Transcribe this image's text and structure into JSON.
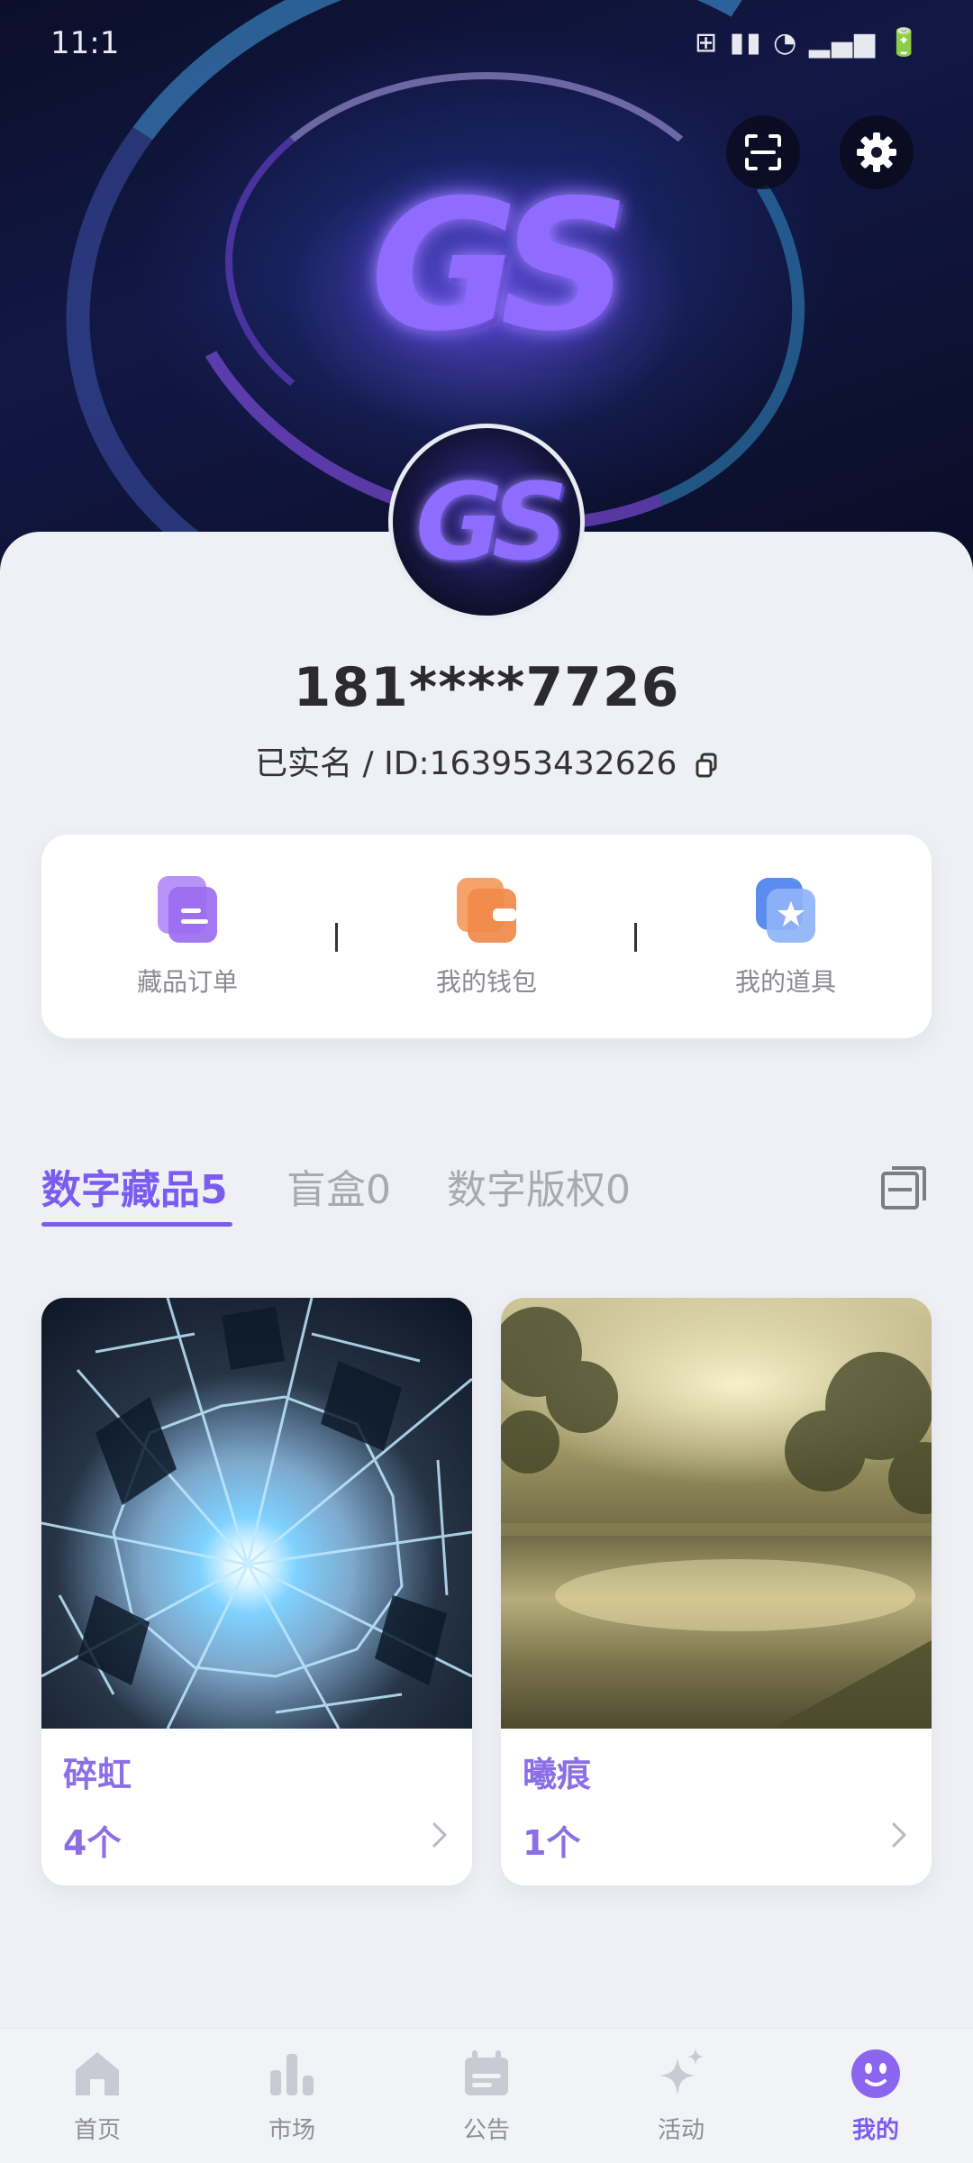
{
  "status_bar": {
    "time": "11:1",
    "icons_text": "⊞ ▮▮ ◔ ▂▄▆ 🔋"
  },
  "header": {
    "logo_text": "GS",
    "scan_icon": "scan-icon",
    "settings_icon": "gear-icon"
  },
  "profile": {
    "avatar_text": "GS",
    "phone": "181****7726",
    "id_line": "已实名 / ID:163953432626"
  },
  "actions": [
    {
      "label": "藏品订单",
      "icon": "order-icon",
      "color": "#9b6cf0"
    },
    {
      "label": "我的钱包",
      "icon": "wallet-icon",
      "color": "#f08a4b"
    },
    {
      "label": "我的道具",
      "icon": "props-icon",
      "color": "#5b8cf0"
    }
  ],
  "tabs": [
    {
      "label": "数字藏品5",
      "active": true
    },
    {
      "label": "盲盒0",
      "active": false
    },
    {
      "label": "数字版权0",
      "active": false
    }
  ],
  "collections": [
    {
      "title": "碎虹",
      "count": "4个"
    },
    {
      "title": "曦痕",
      "count": "1个"
    }
  ],
  "bottom_nav": [
    {
      "label": "首页",
      "icon": "home-icon",
      "active": false
    },
    {
      "label": "市场",
      "icon": "market-icon",
      "active": false
    },
    {
      "label": "公告",
      "icon": "notice-icon",
      "active": false
    },
    {
      "label": "活动",
      "icon": "sparkle-icon",
      "active": false
    },
    {
      "label": "我的",
      "icon": "profile-face-icon",
      "active": true
    }
  ],
  "colors": {
    "accent": "#7b5cf0",
    "background": "#eef0f5"
  }
}
